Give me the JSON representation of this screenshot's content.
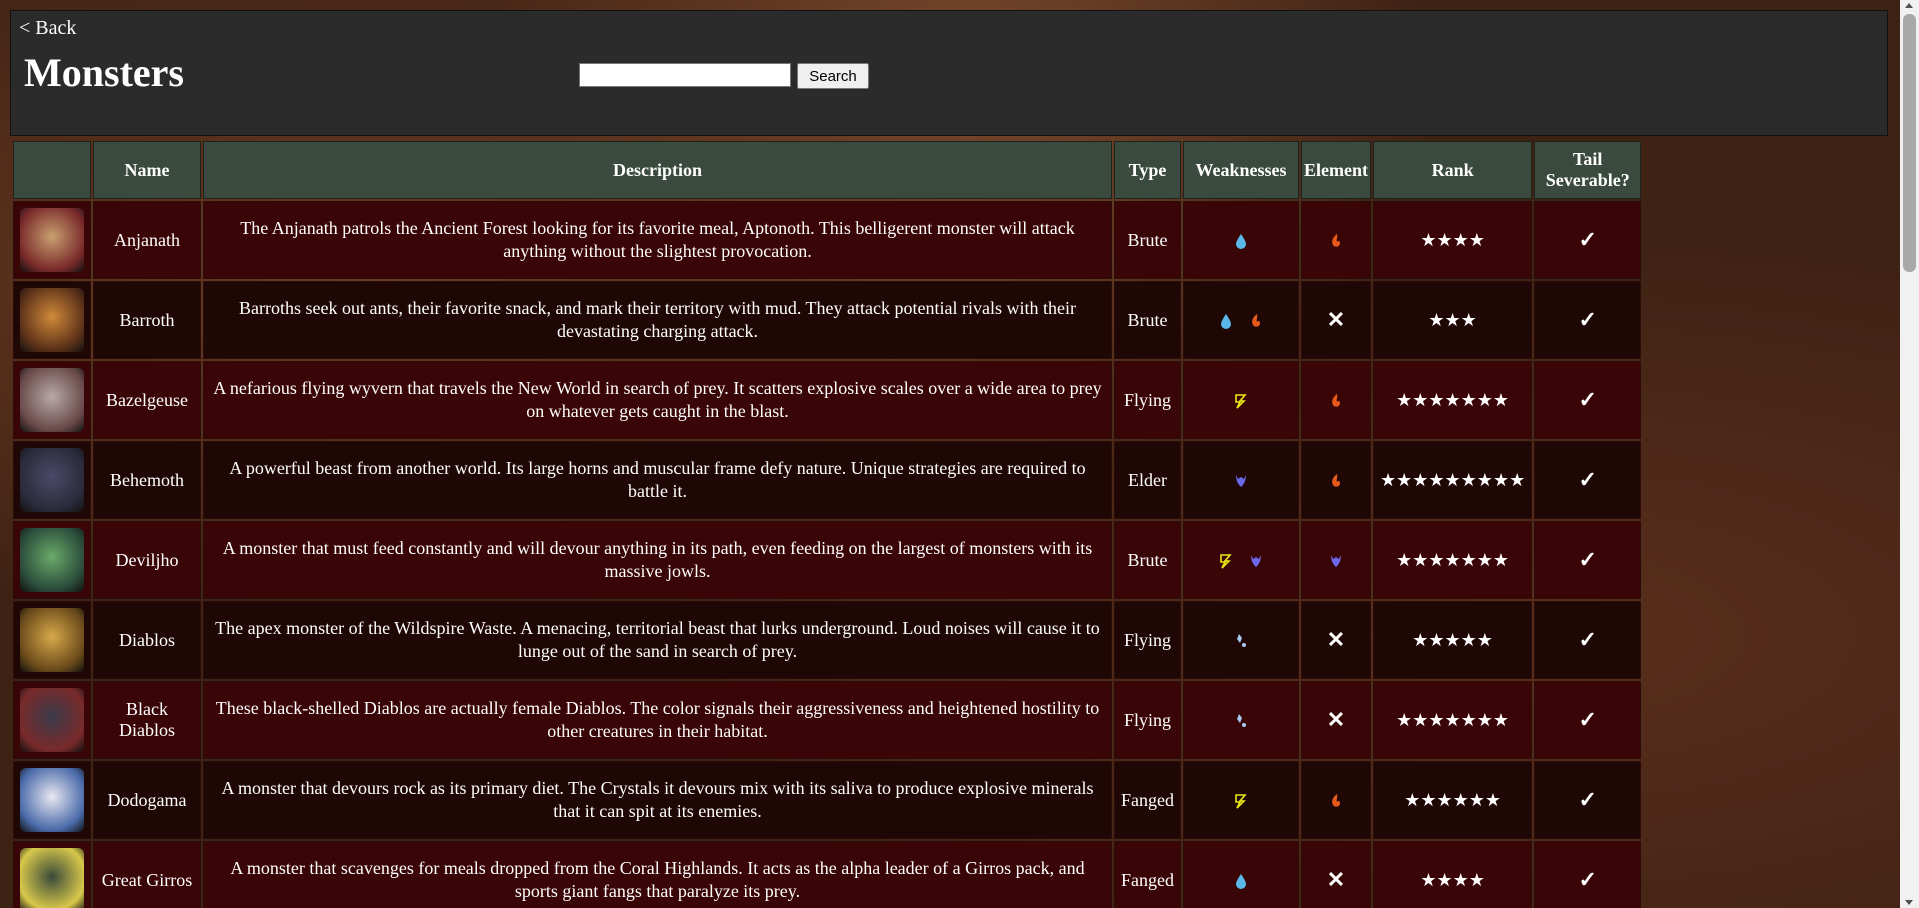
{
  "nav": {
    "back_label": "< Back"
  },
  "page": {
    "title": "Monsters"
  },
  "search": {
    "button_label": "Search",
    "value": ""
  },
  "table": {
    "headers": {
      "icon": "",
      "name": "Name",
      "description": "Description",
      "type": "Type",
      "weaknesses": "Weaknesses",
      "element": "Element",
      "rank": "Rank",
      "tail": "Tail Severable?"
    },
    "rows": [
      {
        "name": "Anjanath",
        "description": "The Anjanath patrols the Ancient Forest looking for its favorite meal, Aptonoth. This belligerent monster will attack anything without the slightest provocation.",
        "type": "Brute",
        "weaknesses": [
          "water"
        ],
        "element": [
          "fire"
        ],
        "rank": "★★★★",
        "tail": "✓",
        "icon": {
          "c1": "#c8a070",
          "c2": "#7a2a2a"
        }
      },
      {
        "name": "Barroth",
        "description": "Barroths seek out ants, their favorite snack, and mark their territory with mud. They attack potential rivals with their devastating charging attack.",
        "type": "Brute",
        "weaknesses": [
          "water",
          "fire"
        ],
        "element": [],
        "rank": "★★★",
        "tail": "✓",
        "icon": {
          "c1": "#d08a3a",
          "c2": "#5a3018"
        }
      },
      {
        "name": "Bazelgeuse",
        "description": "A nefarious flying wyvern that travels the New World in search of prey. It scatters explosive scales over a wide area to prey on whatever gets caught in the blast.",
        "type": "Flying",
        "weaknesses": [
          "thunder"
        ],
        "element": [
          "fire"
        ],
        "rank": "★★★★★★★",
        "tail": "✓",
        "icon": {
          "c1": "#b8a8a8",
          "c2": "#6a4a4a"
        }
      },
      {
        "name": "Behemoth",
        "description": "A powerful beast from another world. Its large horns and muscular frame defy nature. Unique strategies are required to battle it.",
        "type": "Elder",
        "weaknesses": [
          "dragon"
        ],
        "element": [
          "fire"
        ],
        "rank": "★★★★★★★★★",
        "tail": "✓",
        "icon": {
          "c1": "#4a4a6a",
          "c2": "#2a2a3a"
        }
      },
      {
        "name": "Deviljho",
        "description": "A monster that must feed constantly and will devour anything in its path, even feeding on the largest of monsters with its massive jowls.",
        "type": "Brute",
        "weaknesses": [
          "thunder",
          "dragon"
        ],
        "element": [
          "dragon"
        ],
        "rank": "★★★★★★★",
        "tail": "✓",
        "icon": {
          "c1": "#6aaa6a",
          "c2": "#2a4a3a"
        }
      },
      {
        "name": "Diablos",
        "description": "The apex monster of the Wildspire Waste. A menacing, territorial beast that lurks underground. Loud noises will cause it to lunge out of the sand in search of prey.",
        "type": "Flying",
        "weaknesses": [
          "ice"
        ],
        "element": [],
        "rank": "★★★★★",
        "tail": "✓",
        "icon": {
          "c1": "#d8a84a",
          "c2": "#6a4a1a"
        }
      },
      {
        "name": "Black Diablos",
        "description": "These black-shelled Diablos are actually female Diablos. The color signals their aggressiveness and heightened hostility to other creatures in their habitat.",
        "type": "Flying",
        "weaknesses": [
          "ice"
        ],
        "element": [],
        "rank": "★★★★★★★",
        "tail": "✓",
        "icon": {
          "c1": "#3a3a4a",
          "c2": "#7a2a2a"
        }
      },
      {
        "name": "Dodogama",
        "description": "A monster that devours rock as its primary diet. The Crystals it devours mix with its saliva to produce explosive minerals that it can spit at its enemies.",
        "type": "Fanged",
        "weaknesses": [
          "thunder"
        ],
        "element": [
          "fire"
        ],
        "rank": "★★★★★★",
        "tail": "✓",
        "icon": {
          "c1": "#e8e8f0",
          "c2": "#4a6aaa"
        }
      },
      {
        "name": "Great Girros",
        "description": "A monster that scavenges for meals dropped from the Coral Highlands. It acts as the alpha leader of a Girros pack, and sports giant fangs that paralyze its prey.",
        "type": "Fanged",
        "weaknesses": [
          "water"
        ],
        "element": [],
        "rank": "★★★★",
        "tail": "✓",
        "icon": {
          "c1": "#3a4a3a",
          "c2": "#d8c84a"
        }
      }
    ],
    "no_element_symbol": "✕"
  },
  "colors": {
    "header_bg": "#3b4a3e",
    "row_odd": "#3a0507",
    "row_even": "#1f0706",
    "water": "#5ab8e8",
    "fire": "#e85a1a",
    "thunder": "#e8e81a",
    "dragon": "#6a6ae8",
    "ice": "#a8c8f0"
  }
}
